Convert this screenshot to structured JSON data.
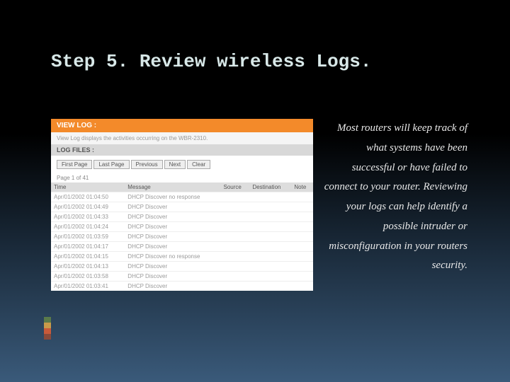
{
  "title": "Step 5. Review wireless Logs.",
  "body": "Most routers will keep track of what systems have been successful or have failed to connect to your router. Reviewing your logs can help identify a possible intruder or misconfiguration in your routers security.",
  "screenshot": {
    "header": "VIEW LOG :",
    "sub": "View Log displays the activities occurring on the WBR-2310.",
    "logheader": "LOG FILES :",
    "buttons": [
      "First Page",
      "Last Page",
      "Previous",
      "Next",
      "Clear"
    ],
    "pageinfo": "Page 1 of 41",
    "columns": [
      "Time",
      "Message",
      "Source",
      "Destination",
      "Note"
    ],
    "rows": [
      {
        "time": "Apr/01/2002 01:04:50",
        "msg": "DHCP Discover no response"
      },
      {
        "time": "Apr/01/2002 01:04:49",
        "msg": "DHCP Discover"
      },
      {
        "time": "Apr/01/2002 01:04:33",
        "msg": "DHCP Discover"
      },
      {
        "time": "Apr/01/2002 01:04:24",
        "msg": "DHCP Discover"
      },
      {
        "time": "Apr/01/2002 01:03:59",
        "msg": "DHCP Discover"
      },
      {
        "time": "Apr/01/2002 01:04:17",
        "msg": "DHCP Discover"
      },
      {
        "time": "Apr/01/2002 01:04:15",
        "msg": "DHCP Discover no response"
      },
      {
        "time": "Apr/01/2002 01:04:13",
        "msg": "DHCP Discover"
      },
      {
        "time": "Apr/01/2002 01:03:58",
        "msg": "DHCP Discover"
      },
      {
        "time": "Apr/01/2002 01:03:41",
        "msg": "DHCP Discover"
      }
    ]
  }
}
